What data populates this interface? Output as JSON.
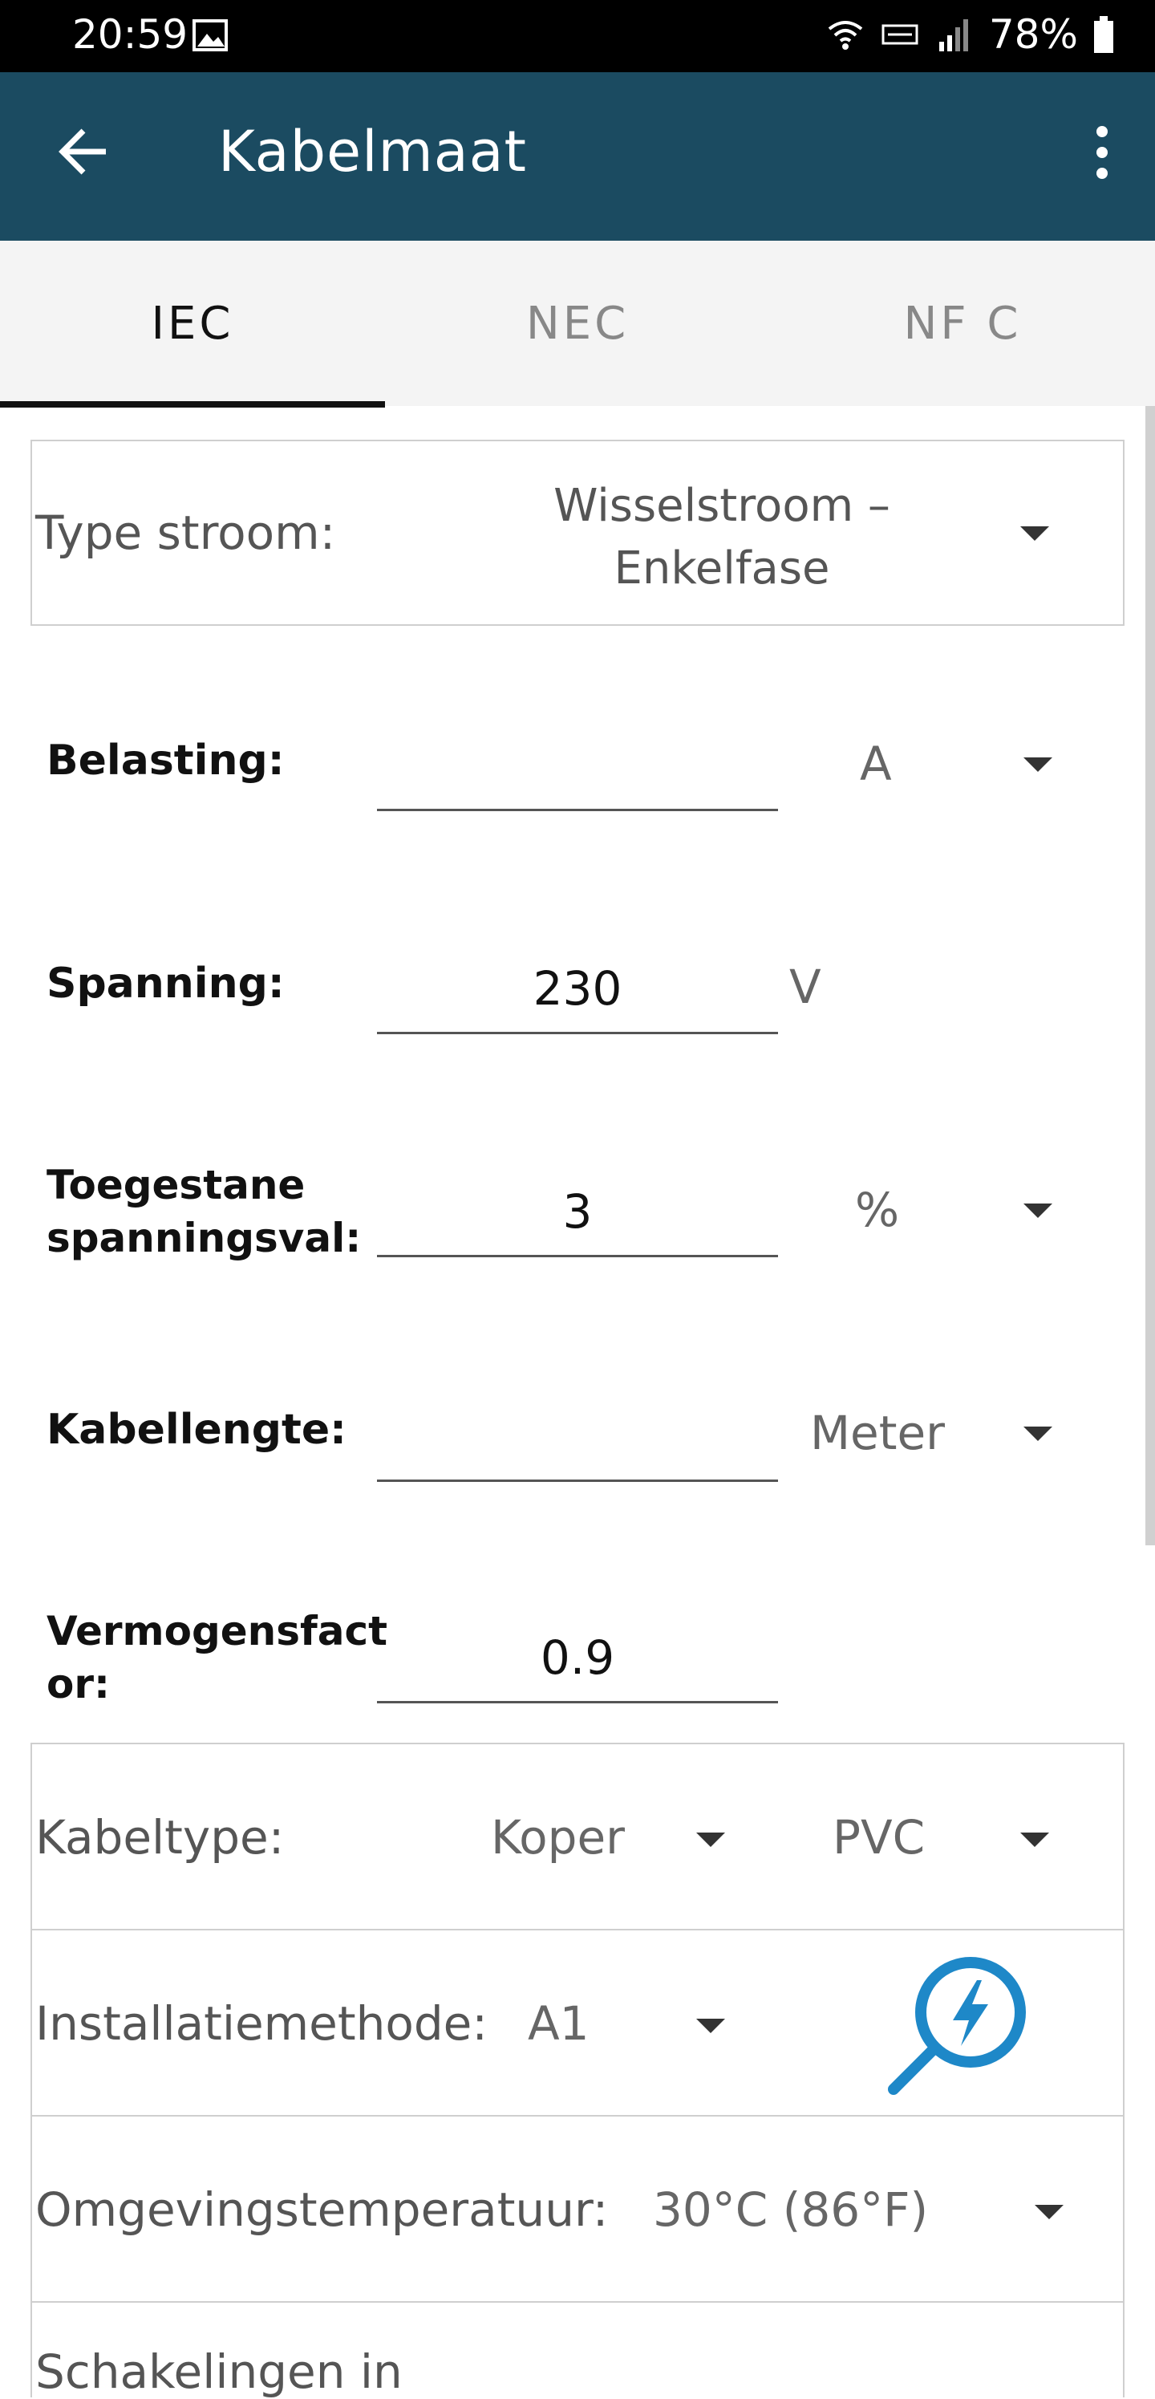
{
  "status_bar": {
    "time": "20:59",
    "battery": "78%"
  },
  "app_bar": {
    "title": "Kabelmaat"
  },
  "tabs": [
    {
      "label": "IEC"
    },
    {
      "label": "NEC"
    },
    {
      "label": "NF C"
    }
  ],
  "current_type": {
    "label": "Type stroom:",
    "value_line1": "Wisselstroom –",
    "value_line2": "Enkelfase"
  },
  "load": {
    "label": "Belasting:",
    "value": "",
    "unit": "A"
  },
  "voltage": {
    "label": "Spanning:",
    "value": "230",
    "unit": "V"
  },
  "voltage_drop": {
    "label_line1": "Toegestane",
    "label_line2": "spanningsval:",
    "value": "3",
    "unit": "%"
  },
  "cable_length": {
    "label": "Kabellengte:",
    "value": "",
    "unit": "Meter"
  },
  "power_factor": {
    "label_line1": "Vermogensfact",
    "label_line2": "or:",
    "value": "0.9"
  },
  "cable_type": {
    "label": "Kabeltype:",
    "conductor": "Koper",
    "insulation": "PVC"
  },
  "installation": {
    "label": "Installatiemethode:",
    "value": "A1"
  },
  "ambient_temp": {
    "label": "Omgevingstemperatuur:",
    "value": "30°C (86°F)"
  },
  "partial_row": {
    "label": "Schakelingen in"
  },
  "colors": {
    "appbar": "#1b4b61",
    "accent_icon": "#1e88c8"
  }
}
